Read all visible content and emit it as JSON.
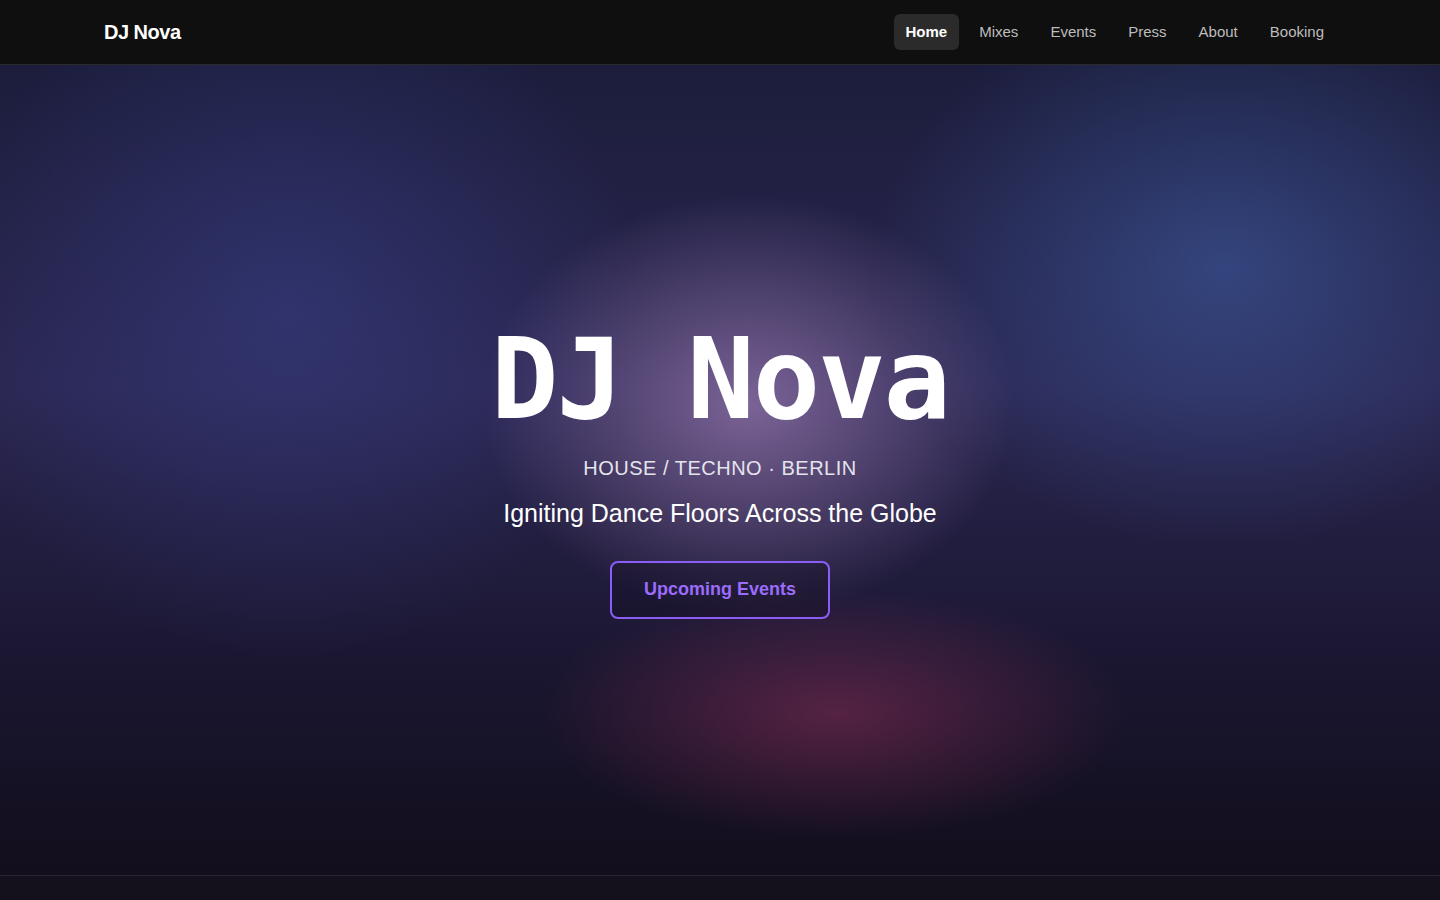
{
  "brand": "DJ Nova",
  "nav": [
    {
      "label": "Home",
      "selected": true
    },
    {
      "label": "Mixes",
      "selected": false
    },
    {
      "label": "Events",
      "selected": false
    },
    {
      "label": "Press",
      "selected": false
    },
    {
      "label": "About",
      "selected": false
    },
    {
      "label": "Booking",
      "selected": false
    }
  ],
  "hero": {
    "title": "DJ Nova",
    "subtitle": "HOUSE / TECHNO · BERLIN",
    "tagline": "Igniting Dance Floors Across the Globe",
    "button": "Upcoming Events"
  }
}
